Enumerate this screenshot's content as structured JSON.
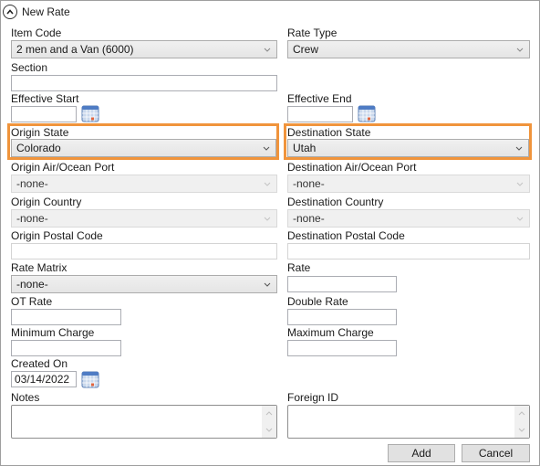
{
  "header": {
    "title": "New Rate",
    "collapse_icon": "chevron-up-circle-icon"
  },
  "left": {
    "item_code": {
      "label": "Item Code",
      "value": "2 men and a Van (6000)"
    },
    "section": {
      "label": "Section",
      "value": ""
    },
    "effective_start": {
      "label": "Effective Start",
      "value": ""
    },
    "origin_state": {
      "label": "Origin State",
      "value": "Colorado"
    },
    "origin_port": {
      "label": "Origin Air/Ocean Port",
      "value": "-none-"
    },
    "origin_country": {
      "label": "Origin Country",
      "value": "-none-"
    },
    "origin_postal": {
      "label": "Origin Postal Code",
      "value": ""
    },
    "rate_matrix": {
      "label": "Rate Matrix",
      "value": "-none-"
    },
    "ot_rate": {
      "label": "OT Rate",
      "value": ""
    },
    "minimum_charge": {
      "label": "Minimum Charge",
      "value": ""
    },
    "created_on": {
      "label": "Created On",
      "value": "03/14/2022"
    },
    "notes": {
      "label": "Notes",
      "value": ""
    }
  },
  "right": {
    "rate_type": {
      "label": "Rate Type",
      "value": "Crew"
    },
    "effective_end": {
      "label": "Effective End",
      "value": ""
    },
    "destination_state": {
      "label": "Destination State",
      "value": "Utah"
    },
    "destination_port": {
      "label": "Destination Air/Ocean Port",
      "value": "-none-"
    },
    "destination_country": {
      "label": "Destination Country",
      "value": "-none-"
    },
    "destination_postal": {
      "label": "Destination Postal Code",
      "value": ""
    },
    "rate": {
      "label": "Rate",
      "value": ""
    },
    "double_rate": {
      "label": "Double Rate",
      "value": ""
    },
    "maximum_charge": {
      "label": "Maximum Charge",
      "value": ""
    },
    "foreign_id": {
      "label": "Foreign ID",
      "value": ""
    }
  },
  "buttons": {
    "add": "Add",
    "cancel": "Cancel"
  },
  "colors": {
    "highlight": "#f0943c"
  }
}
